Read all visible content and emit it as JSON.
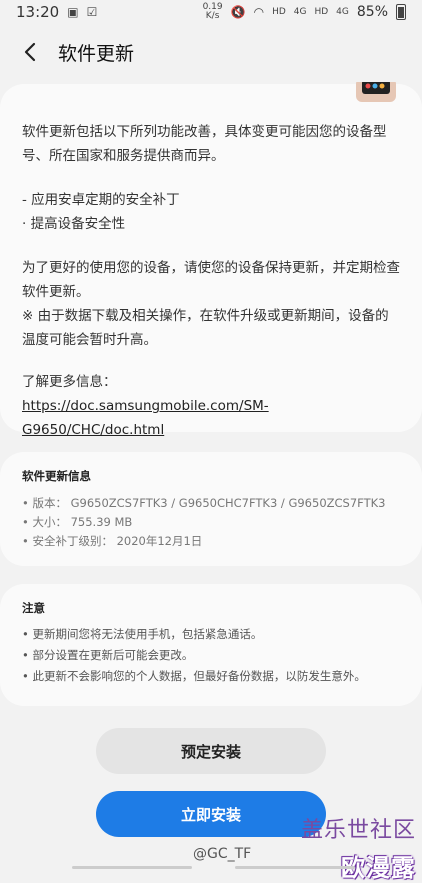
{
  "status_bar": {
    "time": "13:20",
    "net_speed": "0.19\nK/s",
    "hd1": "HD",
    "sig1": "4G",
    "hd2": "HD",
    "sig2": "4G",
    "battery": "85%"
  },
  "header": {
    "title": "软件更新"
  },
  "description": {
    "intro": "软件更新包括以下所列功能改善，具体变更可能因您的设备型号、所在国家和服务提供商而异。",
    "bullet1": "- 应用安卓定期的安全补丁",
    "bullet2": "· 提高设备安全性",
    "advice": "为了更好的使用您的设备，请使您的设备保持更新，并定期检查软件更新。",
    "warning": "※ 由于数据下载及相关操作，在软件升级或更新期间，设备的温度可能会暂时升高。",
    "more_info_label": "了解更多信息：",
    "more_info_link": "https://doc.samsungmobile.com/SM-G9650/CHC/doc.html"
  },
  "update_info": {
    "title": "软件更新信息",
    "version": "• 版本：  G9650ZCS7FTK3 / G9650CHC7FTK3 / G9650ZCS7FTK3",
    "size": "• 大小：  755.39 MB",
    "patch": "• 安全补丁级别：  2020年12月1日"
  },
  "notes": {
    "title": "注意",
    "n1": "• 更新期间您将无法使用手机，包括紧急通话。",
    "n2": "• 部分设置在更新后可能会更改。",
    "n3": "• 此更新不会影响您的个人数据，但最好备份数据，以防发生意外。"
  },
  "buttons": {
    "schedule": "预定安装",
    "install": "立即安装"
  },
  "watermark": {
    "line1": "盖乐世社区",
    "line2": "@GC_TF",
    "line3": "欧漫露"
  }
}
